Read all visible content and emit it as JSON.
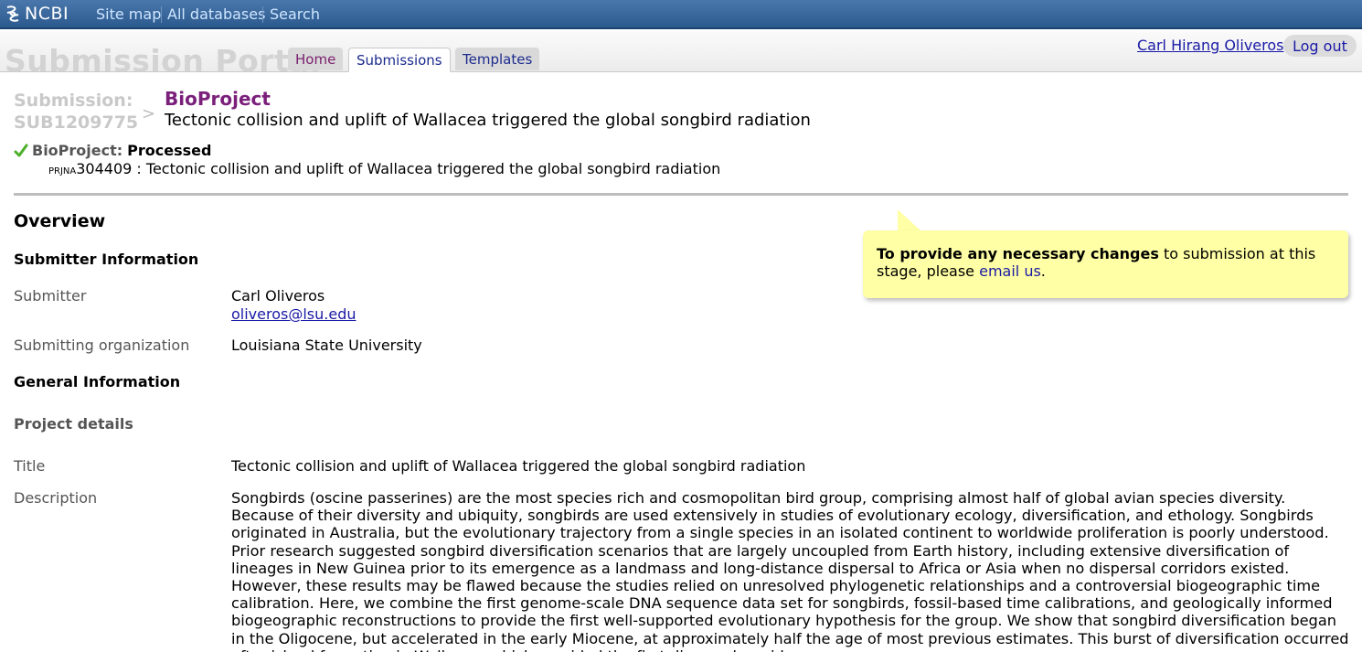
{
  "ncbi_bar": {
    "logo_text": "NCBI",
    "links": [
      "Site map",
      "All databases",
      "Search"
    ]
  },
  "portal": {
    "title": "Submission Portal",
    "tabs": [
      "Home",
      "Submissions",
      "Templates"
    ],
    "active_tab": "Submissions",
    "user_name": "Carl Hirang Oliveros",
    "logout_label": "Log out"
  },
  "submission": {
    "label_line1": "Submission:",
    "label_line2": "SUB1209775",
    "arrow": ">",
    "type": "BioProject",
    "title": "Tectonic collision and uplift of Wallacea triggered the global songbird radiation",
    "status_label": "BioProject:",
    "status_value": "Processed",
    "accession_prefix": "PRJNA",
    "accession_number": "304409",
    "accession_title": " : Tectonic collision and uplift of Wallacea triggered the global songbird radiation"
  },
  "note": {
    "strong": "To provide any necessary changes",
    "text": " to submission at this stage, please ",
    "link": "email us",
    "end": "."
  },
  "overview": {
    "title": "Overview",
    "submitter_section": "Submitter Information",
    "submitter_label": "Submitter",
    "submitter_name": "Carl Oliveros",
    "submitter_email": "oliveros@lsu.edu",
    "org_label": "Submitting organization",
    "org_value": "Louisiana State University",
    "general_section": "General Information",
    "project_details": "Project details",
    "title_label": "Title",
    "title_value": "Tectonic collision and uplift of Wallacea triggered the global songbird radiation",
    "description_label": "Description",
    "description_value": "Songbirds (oscine passerines) are the most species rich and cosmopolitan bird group, comprising almost half of global avian species diversity. Because of their diversity and ubiquity, songbirds are used extensively in studies of evolutionary ecology, diversification, and ethology. Songbirds originated in Australia, but the evolutionary trajectory from a single species in an isolated continent to worldwide proliferation is poorly understood. Prior research suggested songbird diversification scenarios that are largely uncoupled from Earth history, including extensive diversification of lineages in New Guinea prior to its emergence as a landmass and long-distance dispersal to Africa or Asia when no dispersal corridors existed. However, these results may be flawed because the studies relied on unresolved phylogenetic relationships and a controversial biogeographic time calibration. Here, we combine the first genome-scale DNA sequence data set for songbirds, fossil-based time calibrations, and geologically informed biogeographic reconstructions to provide the first well-supported evolutionary hypothesis for the group. We show that songbird diversification began in the Oligocene, but accelerated in the early Miocene, at approximately half the age of most previous estimates. This burst of diversification occurred after island formation in Wallacea, which provided the first dispersal corridor"
  },
  "colors": {
    "ncbi_bar": "#3a6a9f",
    "note_bg": "#ffffa5",
    "bioproject_purple": "#7a1f7a",
    "link_blue": "#1a1aa6",
    "check_green": "#4caf2a"
  },
  "icons": [
    "ncbi-logo-icon",
    "check-icon"
  ]
}
